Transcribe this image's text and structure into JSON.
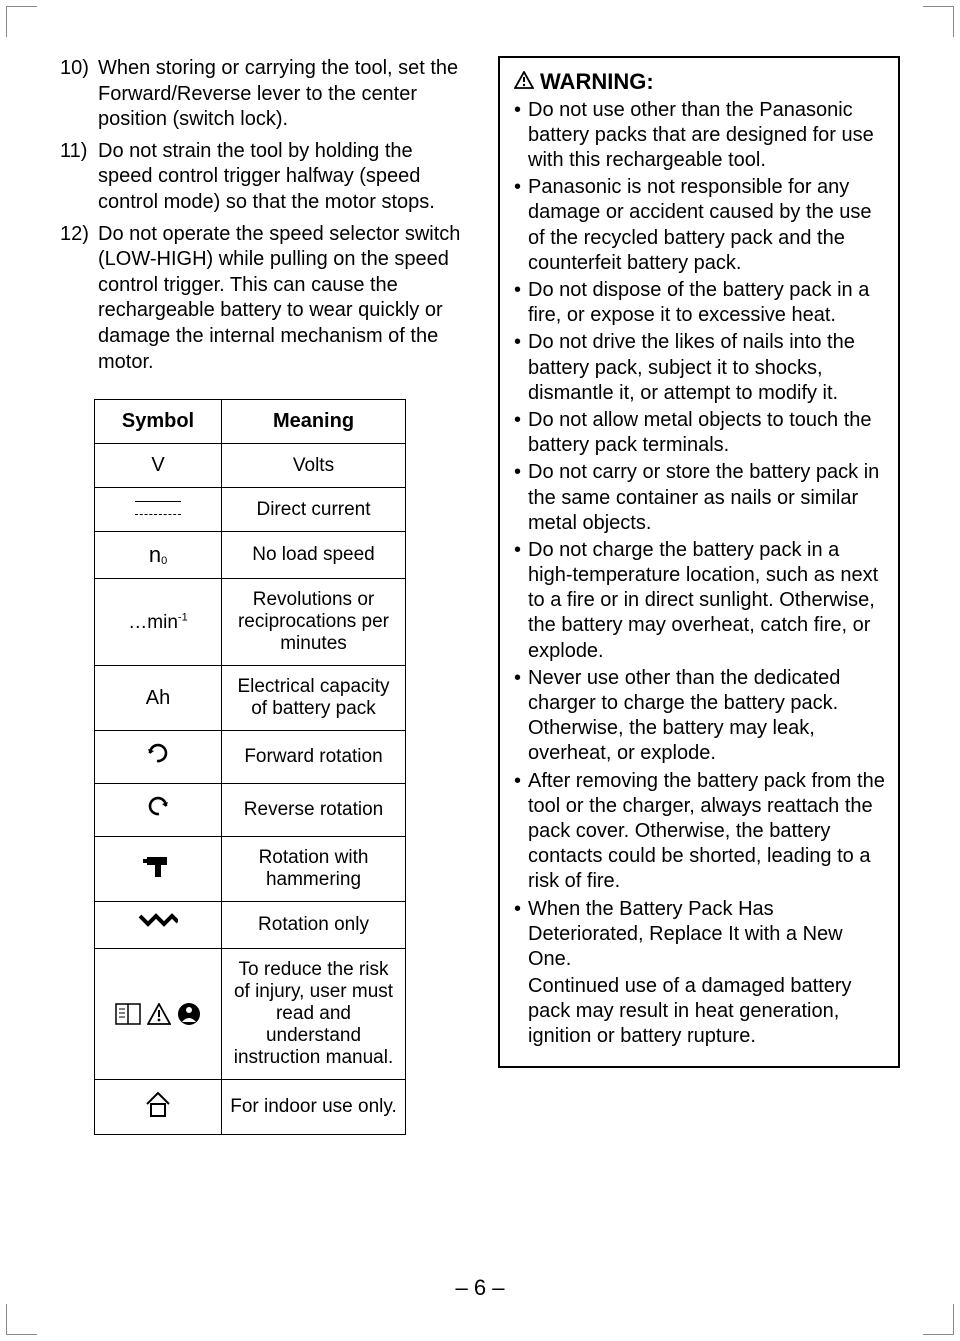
{
  "page_number": "– 6 –",
  "left": {
    "items": [
      {
        "num": "10)",
        "text": "When storing or carrying the tool, set the Forward/Reverse lever to the center position (switch lock)."
      },
      {
        "num": "11)",
        "text": "Do not strain the tool by holding the speed control trigger halfway (speed control mode) so that the motor stops."
      },
      {
        "num": "12)",
        "text": "Do not operate the speed selector switch (LOW-HIGH) while pulling on the speed control trigger. This can cause the rechargeable battery to wear quickly or damage the internal mechanism of the motor."
      }
    ],
    "table": {
      "headers": {
        "symbol": "Symbol",
        "meaning": "Meaning"
      },
      "rows": [
        {
          "symbol_text": "V",
          "meaning": "Volts",
          "symbol_kind": "text"
        },
        {
          "symbol_text": "",
          "meaning": "Direct current",
          "symbol_kind": "dc"
        },
        {
          "symbol_text": "n₀",
          "meaning": "No load speed",
          "symbol_kind": "n0"
        },
        {
          "symbol_text": "…min⁻¹",
          "meaning": "Revolutions or reciprocations per minutes",
          "symbol_kind": "min"
        },
        {
          "symbol_text": "Ah",
          "meaning": "Electrical capacity of battery pack",
          "symbol_kind": "text"
        },
        {
          "symbol_text": "",
          "meaning": "Forward rotation",
          "symbol_kind": "fwd"
        },
        {
          "symbol_text": "",
          "meaning": "Reverse rotation",
          "symbol_kind": "rev"
        },
        {
          "symbol_text": "",
          "meaning": "Rotation with hammering",
          "symbol_kind": "hammer"
        },
        {
          "symbol_text": "",
          "meaning": "Rotation only",
          "symbol_kind": "drill"
        },
        {
          "symbol_text": "",
          "meaning": "To reduce the risk of injury, user must read and understand instruction manual.",
          "symbol_kind": "manual"
        },
        {
          "symbol_text": "",
          "meaning": "For indoor use only.",
          "symbol_kind": "house"
        }
      ]
    }
  },
  "warning": {
    "title": "WARNING:",
    "bullets": [
      "Do not use other than the Panasonic battery packs that are designed for use with this rechargeable tool.",
      "Panasonic is not responsible for any damage or accident caused by the use of the recycled battery pack and the counterfeit battery pack.",
      "Do not dispose of the battery pack in a fire, or expose it to excessive heat.",
      "Do not drive the likes of nails into the battery pack, subject it to shocks, dismantle it, or attempt to modify it.",
      "Do not allow metal objects to touch the battery pack terminals.",
      "Do not carry or store the battery pack in the same container as nails or similar metal objects.",
      "Do not charge the battery pack in a high-temperature location, such as next to a fire or in direct sunlight. Otherwise, the battery may overheat, catch fire, or explode.",
      "Never use other than the dedicated charger to charge the battery pack. Otherwise, the battery may leak, overheat, or explode.",
      "After removing the battery pack from the tool or the charger, always reattach the pack cover. Otherwise, the battery contacts could be shorted, leading to a risk of fire.",
      "When the Battery Pack Has Deteriorated, Replace It with a New One."
    ],
    "continuation": "Continued use of a damaged battery pack may result in heat generation, ignition or battery rupture."
  }
}
